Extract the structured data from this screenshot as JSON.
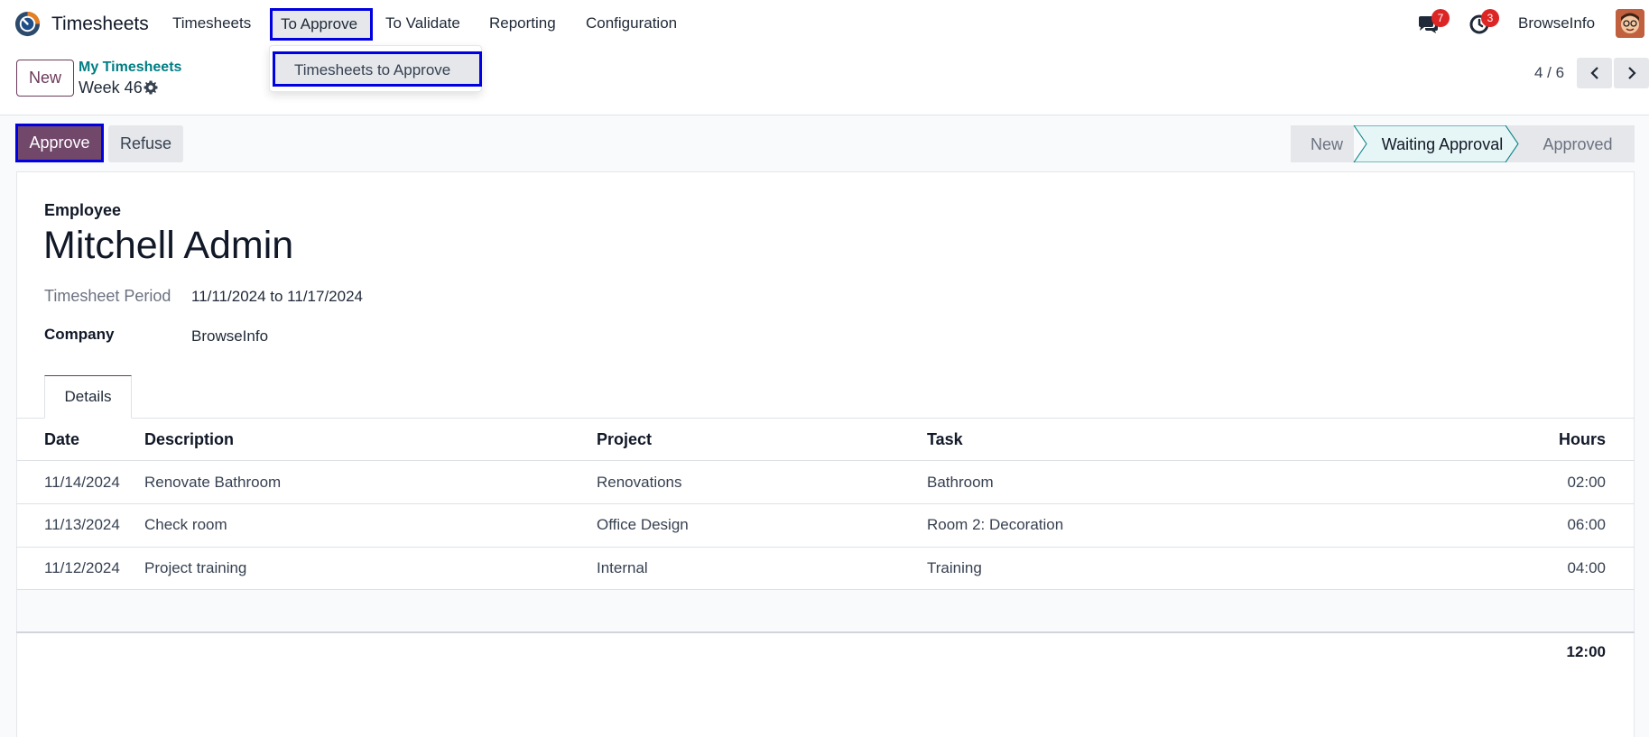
{
  "navbar": {
    "app_name": "Timesheets",
    "menu": [
      "Timesheets",
      "To Approve",
      "To Validate",
      "Reporting",
      "Configuration"
    ],
    "chat_badge": "7",
    "activity_badge": "3",
    "company": "BrowseInfo"
  },
  "dropdown": {
    "item": "Timesheets to Approve"
  },
  "control_panel": {
    "new_label": "New",
    "breadcrumb": "My Timesheets",
    "record_title": "Week 46",
    "pager": "4 / 6"
  },
  "status_bar": {
    "approve_label": "Approve",
    "refuse_label": "Refuse",
    "stages": [
      "New",
      "Waiting Approval",
      "Approved"
    ],
    "current_stage": "Waiting Approval"
  },
  "form": {
    "employee_label": "Employee",
    "employee_name": "Mitchell Admin",
    "period_label": "Timesheet Period",
    "period_value": "11/11/2024 to 11/17/2024",
    "company_label": "Company",
    "company_value": "BrowseInfo"
  },
  "tabs": [
    "Details"
  ],
  "table": {
    "columns": [
      "Date",
      "Description",
      "Project",
      "Task",
      "Hours"
    ],
    "rows": [
      {
        "date": "11/14/2024",
        "description": "Renovate Bathroom",
        "project": "Renovations",
        "task": "Bathroom",
        "hours": "02:00"
      },
      {
        "date": "11/13/2024",
        "description": "Check room",
        "project": "Office Design",
        "task": "Room 2: Decoration",
        "hours": "06:00"
      },
      {
        "date": "11/12/2024",
        "description": "Project training",
        "project": "Internal",
        "task": "Training",
        "hours": "04:00"
      }
    ],
    "total": "12:00"
  },
  "colors": {
    "brand": "#71476a",
    "link": "#017e84",
    "highlight_border": "#0000e0",
    "badge": "#dc2626"
  }
}
